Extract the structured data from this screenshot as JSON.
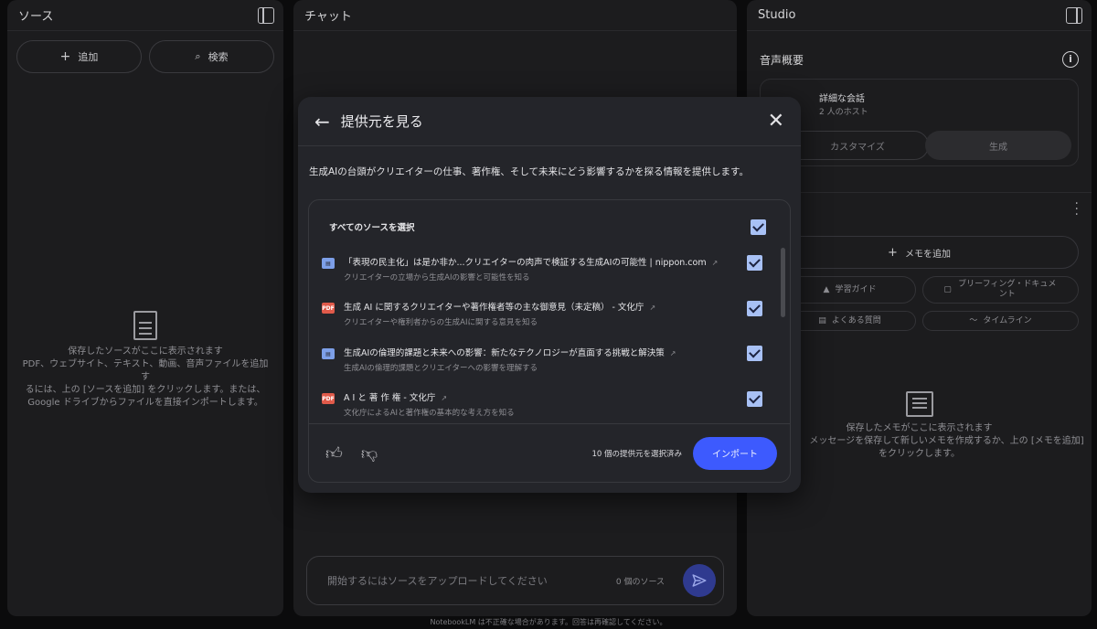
{
  "sources_panel": {
    "title": "ソース",
    "add_label": "追加",
    "search_label": "検索",
    "empty_line1": "保存したソースがここに表示されます",
    "empty_line2": "PDF、ウェブサイト、テキスト、動画、音声ファイルを追加す",
    "empty_line3": "るには、上の [ソースを追加] をクリックします。または、",
    "empty_line4": "Google ドライブからファイルを直接インポートします。"
  },
  "chat_panel": {
    "title": "チャット",
    "input_placeholder": "開始するにはソースをアップロードしてください",
    "source_count": "0 個のソース"
  },
  "studio_panel": {
    "title": "Studio",
    "audio_title": "音声概要",
    "card_title": "詳細な会話",
    "card_sub": "2 人のホスト",
    "customize_label": "カスタマイズ",
    "generate_label": "生成",
    "add_note_label": "メモを追加",
    "chips": [
      "学習ガイド",
      "ブリーフィング・ドキュメント",
      "よくある質問",
      "タイムライン"
    ],
    "empty_line1": "保存したメモがここに表示されます",
    "empty_line2": "メッセージを保存して新しいメモを作成するか、上の [メモを追加]",
    "empty_line3": "をクリックします。"
  },
  "footer": "NotebookLM は不正確な場合があります。回答は再確認してください。",
  "modal": {
    "title": "提供元を見る",
    "description": "生成AIの台頭がクリエイターの仕事、著作権、そして未来にどう影響するかを探る情報を提供します。",
    "select_all": "すべてのソースを選択",
    "items": [
      {
        "type": "web",
        "title": "「表現の民主化」は是か非か...クリエイターの肉声で検証する生成AIの可能性 | nippon.com",
        "subtitle": "クリエイターの立場から生成AIの影響と可能性を知る"
      },
      {
        "type": "pdf",
        "title": "生成 AI に関するクリエイターや著作権者等の主な御意見（未定稿） - 文化庁",
        "subtitle": "クリエイターや権利者からの生成AIに関する意見を知る"
      },
      {
        "type": "web",
        "title": "生成AIの倫理的課題と未来への影響：新たなテクノロジーが直面する挑戦と解決策",
        "subtitle": "生成AIの倫理的課題とクリエイターへの影響を理解する"
      },
      {
        "type": "pdf",
        "title": "A I と 著 作 権 - 文化庁",
        "subtitle": "文化庁によるAIと著作権の基本的な考え方を知る"
      }
    ],
    "selected_count": "10 個の提供元を選択済み",
    "import_label": "インポート"
  }
}
